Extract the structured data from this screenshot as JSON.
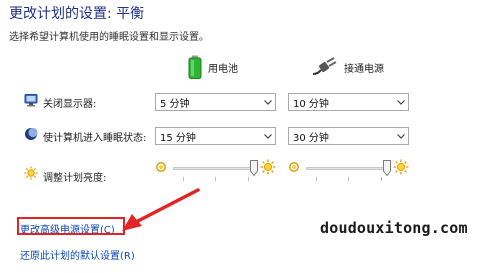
{
  "header": {
    "title": "更改计划的设置: 平衡",
    "subtitle": "选择希望计算机使用的睡眠设置和显示设置。"
  },
  "columns": {
    "battery": {
      "label": "用电池",
      "icon": "battery-icon"
    },
    "plugged": {
      "label": "接通电源",
      "icon": "power-plug-icon"
    }
  },
  "rows": {
    "display_off": {
      "label": "关闭显示器:",
      "icon": "monitor-icon",
      "battery_value": "5 分钟",
      "plugged_value": "10 分钟"
    },
    "sleep": {
      "label": "使计算机进入睡眠状态:",
      "icon": "moon-icon",
      "battery_value": "15 分钟",
      "plugged_value": "30 分钟"
    },
    "brightness": {
      "label": "调整计划亮度:",
      "icon": "sun-icon",
      "battery_level": 1.0,
      "plugged_level": 1.0
    }
  },
  "links": {
    "advanced": "更改高级电源设置(C)",
    "restore": "还原此计划的默认设置(R)"
  },
  "annotation": {
    "highlight_color": "#e12424"
  },
  "watermark": {
    "text": "doudouxitong.com"
  }
}
